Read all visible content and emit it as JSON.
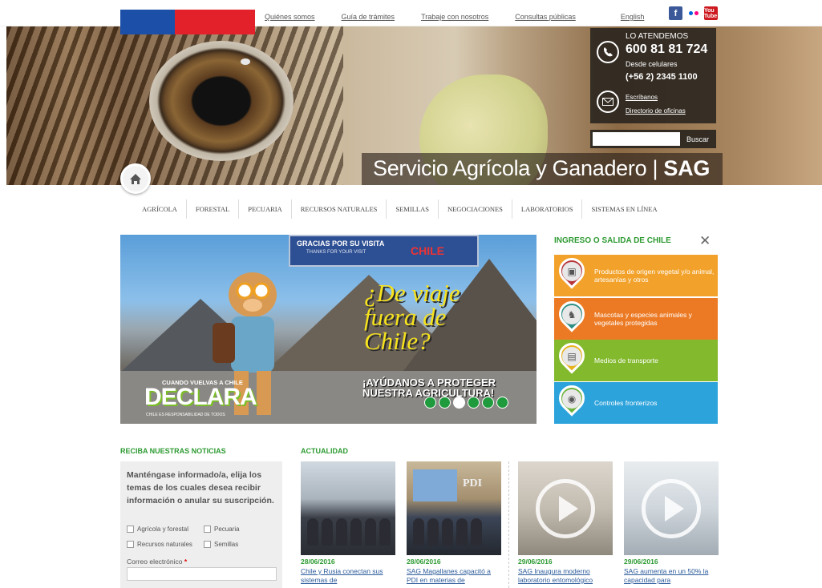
{
  "topbar": {
    "links": [
      "Quiénes somos",
      "Guía de trámites",
      "Trabaje con nosotros",
      "Consultas públicas",
      "English"
    ],
    "social_icons": [
      "facebook-icon",
      "flickr-icon",
      "youtube-icon"
    ],
    "youtube_label": "You Tube"
  },
  "hero": {
    "title_main": "Servicio Agrícola y Ganadero | ",
    "title_bold": "SAG",
    "contact": {
      "label": "LO ATENDEMOS",
      "phone": "600 81 81 724",
      "mobile_label": "Desde celulares",
      "mobile_phone": "(+56 2) 2345 1100",
      "write_link": "Escríbanos",
      "offices_link": "Directorio de oficinas"
    },
    "search": {
      "button": "Buscar",
      "placeholder": ""
    }
  },
  "nav": [
    "AGRÍCOLA",
    "FORESTAL",
    "PECUARIA",
    "RECURSOS NATURALES",
    "SEMILLAS",
    "NEGOCIACIONES",
    "LABORATORIOS",
    "SISTEMAS EN LÍNEA"
  ],
  "carousel": {
    "sign_line1": "GRACIAS POR SU VISITA",
    "sign_line2": "THANKS FOR YOUR VISIT",
    "sign_country": "CHILE",
    "headline_l1": "¿De viaje",
    "headline_l2": "fuera de",
    "headline_l3": "Chile?",
    "sub_l1": "¡AYÚDANOS A PROTEGER",
    "sub_l2": "NUESTRA AGRICULTURA!",
    "cuando": "CUANDO VUELVAS A CHILE",
    "declara": "DECLARA",
    "tagline": "CHILE ES RESPONSABILIDAD DE TODOS",
    "slide_count": 6,
    "active_slide": 3
  },
  "ingreso": {
    "title": "INGRESO O SALIDA DE CHILE",
    "tiles": [
      {
        "label": "Productos de origen vegetal y/o animal, artesanías y otros",
        "color": "#f2a22a"
      },
      {
        "label": "Mascotas y especies animales y vegetales protegidas",
        "color": "#ec7a24"
      },
      {
        "label": "Medios de transporte",
        "color": "#83b92d"
      },
      {
        "label": "Controles fronterizos",
        "color": "#2da3dc"
      }
    ]
  },
  "newsletter": {
    "title": "RECIBA NUESTRAS NOTICIAS",
    "intro": "Manténgase informado/a, elija los temas de los cuales desea recibir información o anular su suscripción.",
    "options": [
      "Agrícola y forestal",
      "Pecuaria",
      "Recursos naturales",
      "Semillas"
    ],
    "email_label": "Correo electrónico",
    "required_mark": "*"
  },
  "actualidad": {
    "title": "ACTUALIDAD",
    "items": [
      {
        "date": "28/06/2016",
        "headline": "Chile y Rusia conectan sus sistemas de"
      },
      {
        "date": "28/06/2016",
        "headline": "SAG Magallanes capacitó a PDI en materias de",
        "image_text": "PDI"
      },
      {
        "date": "29/06/2016",
        "headline": "SAG Inaugura moderno laboratorio entomológico"
      },
      {
        "date": "29/06/2016",
        "headline": "SAG aumenta en un 50% la capacidad para"
      }
    ]
  },
  "colors": {
    "accent_green": "#2c9a31",
    "flag_blue": "#1b4fa8",
    "flag_red": "#e2212b"
  }
}
